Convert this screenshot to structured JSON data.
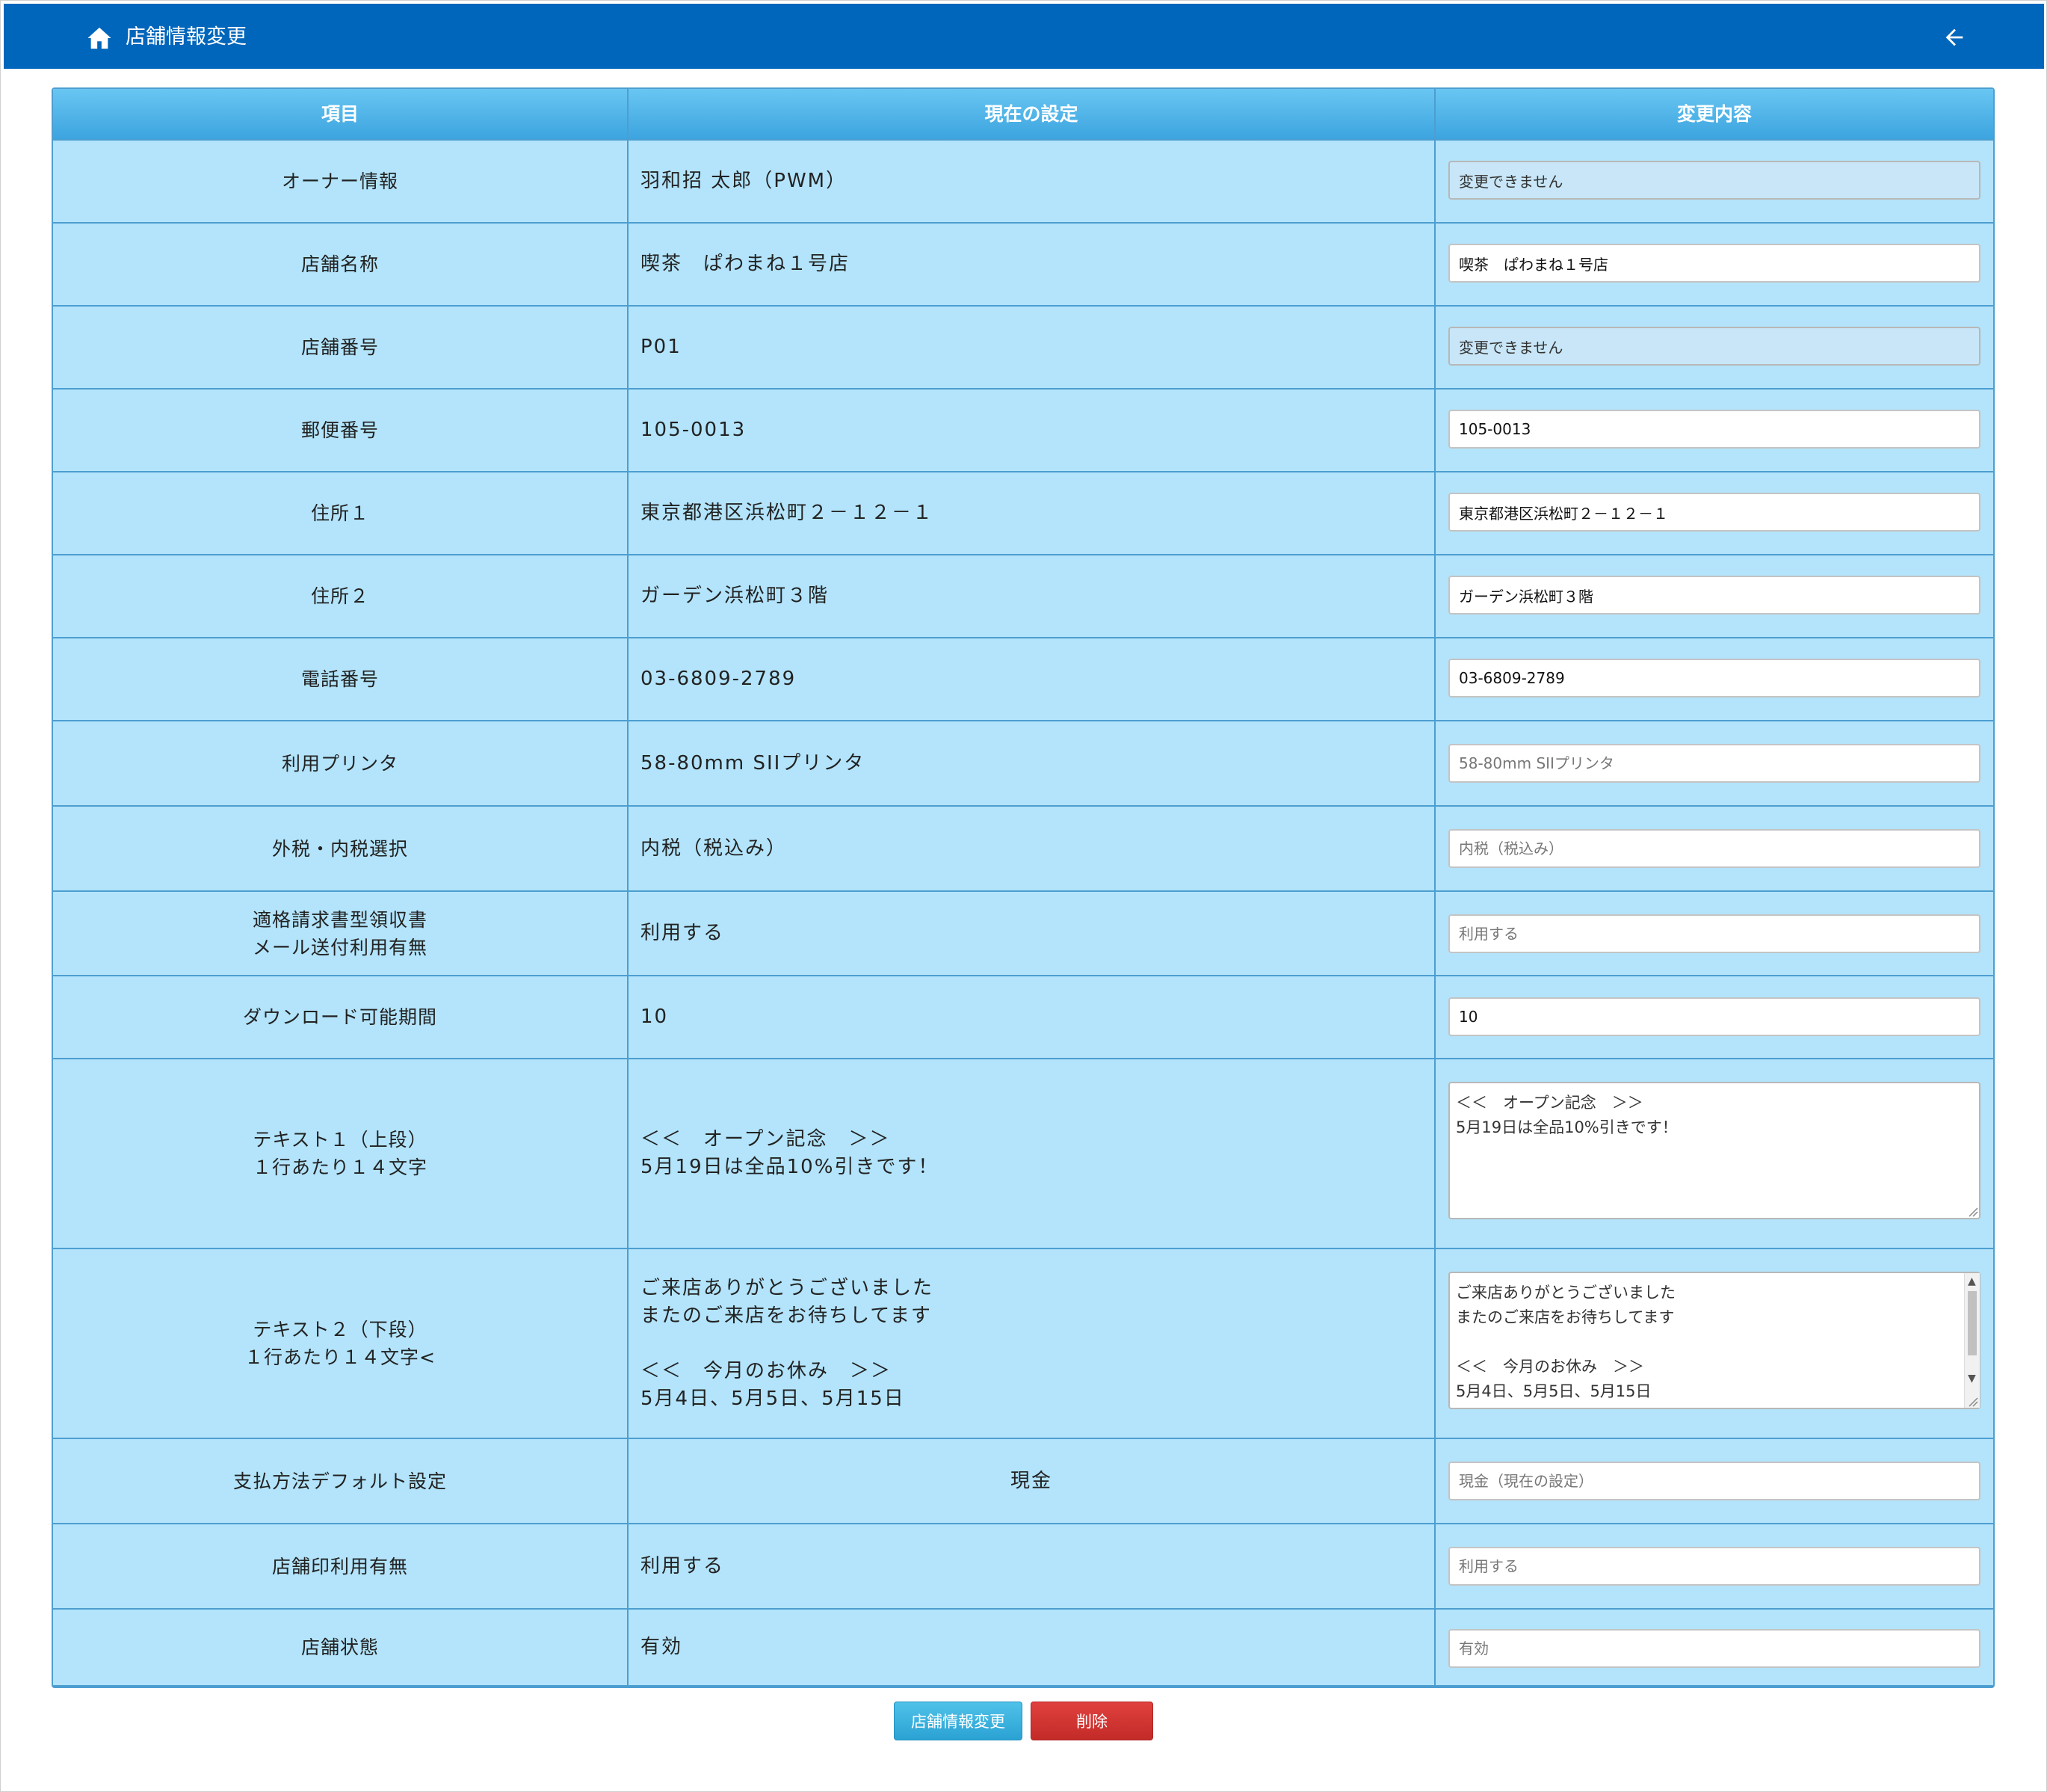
{
  "header": {
    "title": "店舗情報変更",
    "home_icon": "home-icon",
    "back_icon": "arrow-left-icon",
    "bar_color": "#0066bb"
  },
  "table": {
    "columns": [
      "項目",
      "現在の設定",
      "変更内容"
    ],
    "rows": [
      {
        "label": "オーナー情報",
        "current": "羽和招 太郎（PWM）",
        "input_value": "変更できません",
        "input_kind": "disabled"
      },
      {
        "label": "店舗名称",
        "current": "喫茶　ぱわまね１号店",
        "input_value": "喫茶　ぱわまね１号店",
        "input_kind": "text"
      },
      {
        "label": "店舗番号",
        "current": "P01",
        "input_value": "変更できません",
        "input_kind": "disabled"
      },
      {
        "label": "郵便番号",
        "current": "105-0013",
        "input_value": "105-0013",
        "input_kind": "text"
      },
      {
        "label": "住所１",
        "current": "東京都港区浜松町２－１２－１",
        "input_value": "東京都港区浜松町２－１２－１",
        "input_kind": "text"
      },
      {
        "label": "住所２",
        "current": "ガーデン浜松町３階",
        "input_value": "ガーデン浜松町３階",
        "input_kind": "text"
      },
      {
        "label": "電話番号",
        "current": "03-6809-2789",
        "input_value": "03-6809-2789",
        "input_kind": "text"
      },
      {
        "label": "利用プリンタ",
        "current": "58-80mm SIIプリンタ",
        "input_placeholder": "58-80mm SIIプリンタ",
        "input_kind": "select"
      },
      {
        "label": "外税・内税選択",
        "current": "内税（税込み）",
        "input_placeholder": "内税（税込み）",
        "input_kind": "select"
      },
      {
        "label": "適格請求書型領収書\nメール送付利用有無",
        "current": "利用する",
        "input_placeholder": "利用する",
        "input_kind": "select"
      },
      {
        "label": "ダウンロード可能期間",
        "current": "10",
        "input_value": "10",
        "input_kind": "text"
      },
      {
        "label": "テキスト１（上段）\n１行あたり１４文字",
        "current": "＜＜　オープン記念　＞＞\n5月19日は全品10%引きです！",
        "textarea_value": "＜＜　オープン記念　＞＞\n5月19日は全品10%引きです！",
        "input_kind": "textarea"
      },
      {
        "label": "テキスト２（下段）\n１行あたり１４文字<",
        "current": "ご来店ありがとうございました\nまたのご来店をお待ちしてます\n\n＜＜　今月のお休み　＞＞\n5月4日、5月5日、5月15日",
        "textarea_value": "ご来店ありがとうございました\nまたのご来店をお待ちしてます\n\n＜＜　今月のお休み　＞＞\n5月4日、5月5日、5月15日",
        "input_kind": "textarea"
      },
      {
        "label": "支払方法デフォルト設定",
        "current": "現金",
        "input_placeholder": "現金（現在の設定）",
        "input_kind": "select"
      },
      {
        "label": "店舗印利用有無",
        "current": "利用する",
        "input_placeholder": "利用する",
        "input_kind": "select"
      },
      {
        "label": "店舗状態",
        "current": "有効",
        "input_placeholder": "有効",
        "input_kind": "select"
      }
    ]
  },
  "buttons": {
    "update_label": "店舗情報変更",
    "delete_label": "削除"
  },
  "colors": {
    "header_bg": "#0066bb",
    "table_bg": "#b3e4fb",
    "table_header": "#3ca4df",
    "update_button": "#2aa2d3",
    "delete_button": "#c32b28"
  }
}
